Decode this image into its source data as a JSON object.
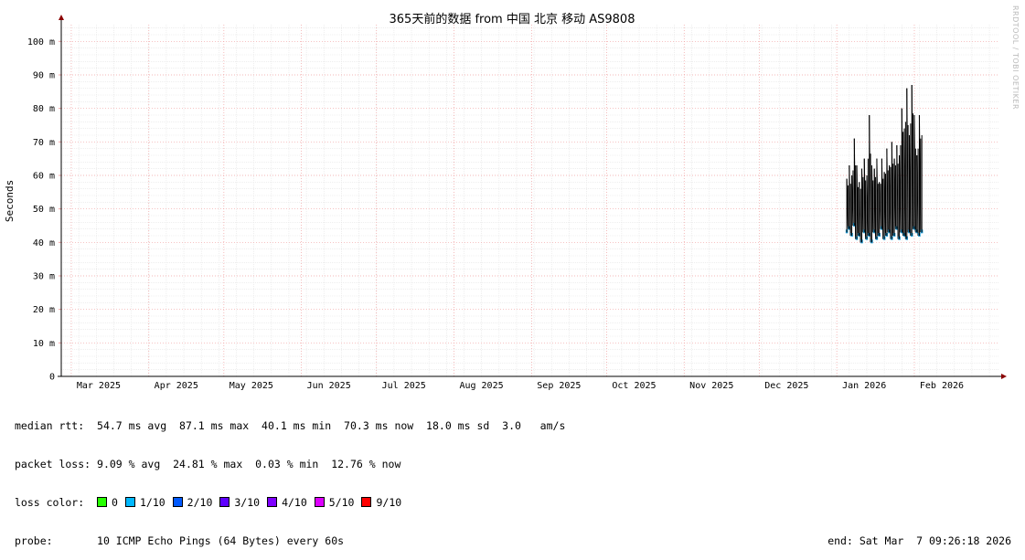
{
  "watermark": "RRDTOOL / TOBI OETIKER",
  "chart_data": {
    "type": "line",
    "title": "365天前的数据 from 中国 北京 移动 AS9808",
    "ylabel": "Seconds",
    "ylim": [
      0,
      105
    ],
    "y_ticks": [
      {
        "v": 0,
        "label": "0"
      },
      {
        "v": 10,
        "label": "10 m"
      },
      {
        "v": 20,
        "label": "20 m"
      },
      {
        "v": 30,
        "label": "30 m"
      },
      {
        "v": 40,
        "label": "40 m"
      },
      {
        "v": 50,
        "label": "50 m"
      },
      {
        "v": 60,
        "label": "60 m"
      },
      {
        "v": 70,
        "label": "70 m"
      },
      {
        "v": 80,
        "label": "80 m"
      },
      {
        "v": 90,
        "label": "90 m"
      },
      {
        "v": 100,
        "label": "100 m"
      }
    ],
    "x_range": [
      "2025-02-25",
      "2026-03-07"
    ],
    "x_ticks": [
      {
        "date": "2025-03-01",
        "label": "Mar 2025"
      },
      {
        "date": "2025-04-01",
        "label": "Apr 2025"
      },
      {
        "date": "2025-05-01",
        "label": "May 2025"
      },
      {
        "date": "2025-06-01",
        "label": "Jun 2025"
      },
      {
        "date": "2025-07-01",
        "label": "Jul 2025"
      },
      {
        "date": "2025-08-01",
        "label": "Aug 2025"
      },
      {
        "date": "2025-09-01",
        "label": "Sep 2025"
      },
      {
        "date": "2025-10-01",
        "label": "Oct 2025"
      },
      {
        "date": "2025-11-01",
        "label": "Nov 2025"
      },
      {
        "date": "2025-12-01",
        "label": "Dec 2025"
      },
      {
        "date": "2026-01-01",
        "label": "Jan 2026"
      },
      {
        "date": "2026-02-01",
        "label": "Feb 2026"
      }
    ],
    "grid": true,
    "series": [
      {
        "color": "#000000",
        "smoke_color": "#1a9ad6",
        "points": [
          {
            "x": "2026-01-05",
            "lo": 43,
            "hi": 59
          },
          {
            "x": "2026-01-06",
            "lo": 44,
            "hi": 63
          },
          {
            "x": "2026-01-07",
            "lo": 42,
            "hi": 60
          },
          {
            "x": "2026-01-08",
            "lo": 45,
            "hi": 71
          },
          {
            "x": "2026-01-09",
            "lo": 41,
            "hi": 63
          },
          {
            "x": "2026-01-10",
            "lo": 42,
            "hi": 58
          },
          {
            "x": "2026-01-11",
            "lo": 40,
            "hi": 62
          },
          {
            "x": "2026-01-12",
            "lo": 43,
            "hi": 65
          },
          {
            "x": "2026-01-13",
            "lo": 41,
            "hi": 60
          },
          {
            "x": "2026-01-14",
            "lo": 42,
            "hi": 78
          },
          {
            "x": "2026-01-15",
            "lo": 40,
            "hi": 63
          },
          {
            "x": "2026-01-16",
            "lo": 43,
            "hi": 62
          },
          {
            "x": "2026-01-17",
            "lo": 41,
            "hi": 65
          },
          {
            "x": "2026-01-18",
            "lo": 42,
            "hi": 58
          },
          {
            "x": "2026-01-19",
            "lo": 44,
            "hi": 65
          },
          {
            "x": "2026-01-20",
            "lo": 41,
            "hi": 61
          },
          {
            "x": "2026-01-21",
            "lo": 42,
            "hi": 68
          },
          {
            "x": "2026-01-22",
            "lo": 43,
            "hi": 63
          },
          {
            "x": "2026-01-23",
            "lo": 41,
            "hi": 70
          },
          {
            "x": "2026-01-24",
            "lo": 42,
            "hi": 65
          },
          {
            "x": "2026-01-25",
            "lo": 44,
            "hi": 69
          },
          {
            "x": "2026-01-26",
            "lo": 41,
            "hi": 66
          },
          {
            "x": "2026-01-27",
            "lo": 43,
            "hi": 80
          },
          {
            "x": "2026-01-28",
            "lo": 42,
            "hi": 74
          },
          {
            "x": "2026-01-29",
            "lo": 41,
            "hi": 86
          },
          {
            "x": "2026-01-30",
            "lo": 43,
            "hi": 72
          },
          {
            "x": "2026-01-31",
            "lo": 42,
            "hi": 87
          },
          {
            "x": "2026-02-01",
            "lo": 44,
            "hi": 78
          },
          {
            "x": "2026-02-02",
            "lo": 43,
            "hi": 66
          },
          {
            "x": "2026-02-03",
            "lo": 42,
            "hi": 78
          },
          {
            "x": "2026-02-04",
            "lo": 43,
            "hi": 72
          }
        ]
      }
    ]
  },
  "legend": {
    "median_label": "median rtt:",
    "median_text": "54.7 ms avg  87.1 ms max  40.1 ms min  70.3 ms now  18.0 ms sd  3.0   am/s",
    "loss_label": "packet loss:",
    "loss_text": "9.09 % avg  24.81 % max  0.03 % min  12.76 % now",
    "color_label": "loss color:",
    "colors": [
      {
        "label": "0",
        "color": "#26ff00"
      },
      {
        "label": "1/10",
        "color": "#00b8ff"
      },
      {
        "label": "2/10",
        "color": "#0059ff"
      },
      {
        "label": "3/10",
        "color": "#5e00ff"
      },
      {
        "label": "4/10",
        "color": "#7e00ff"
      },
      {
        "label": "5/10",
        "color": "#dd00ff"
      },
      {
        "label": "9/10",
        "color": "#ff0000"
      }
    ],
    "probe_label": "probe:",
    "probe_text": "10 ICMP Echo Pings (64 Bytes) every 60s",
    "end_text": "end: Sat Mar  7 09:26:18 2026"
  }
}
